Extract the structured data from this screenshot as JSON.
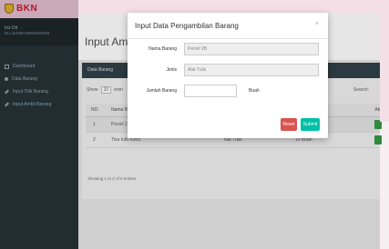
{
  "app": {
    "logo_text": "BKN"
  },
  "sidebar": {
    "profile_name": "Inz Dit",
    "profile_sub": "ELI JUNIS KEMONATIM",
    "items": [
      {
        "label": "Dashboard",
        "icon": "dashboard-icon"
      },
      {
        "label": "Data Barang",
        "icon": "circle-icon"
      },
      {
        "label": "Input Titik Barang",
        "icon": "pencil-icon"
      },
      {
        "label": "Input Ambil Barang",
        "icon": "pencil-icon"
      }
    ]
  },
  "main": {
    "page_title": "Input Ambil",
    "box_title": "Data Barang",
    "show_label": "Show",
    "show_value": "10",
    "entries_label": "entri",
    "search_label": "Search:",
    "table": {
      "headers": [
        "NO",
        "Nama Ba",
        "Aksi"
      ],
      "rows": [
        [
          "1",
          "Pensil 2B",
          "",
          ""
        ],
        [
          "2",
          "Tisa tulis Kecil",
          "Nat Tulis",
          "10 Buah"
        ]
      ]
    },
    "showing_text": "Showing 1 to 2 of 2 entries"
  },
  "modal": {
    "title": "Input Data Pengambilan Barang",
    "close": "×",
    "fields": {
      "nama_label": "Nama Barang",
      "nama_value": "Pensil 2B",
      "jenis_label": "Jenis",
      "jenis_value": "Alat Tulis",
      "jumlah_label": "Jumlah Barang",
      "jumlah_value": "",
      "unit": "Buah"
    },
    "reset_label": "Reset",
    "submit_label": "Submit"
  },
  "colors": {
    "sidebar_bg": "#222d32",
    "box_header": "#2b3a40",
    "reset": "#d9534f",
    "submit": "#00c0a8",
    "action": "#2f8a3d"
  }
}
